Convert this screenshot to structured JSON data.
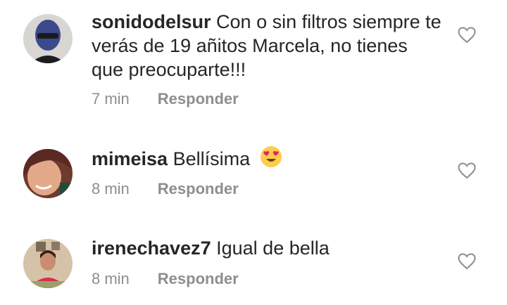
{
  "comments": [
    {
      "username": "sonidodelsur",
      "text": "Con o sin filtros siempre te verás de 19 añitos Marcela, no tienes que preocuparte!!!",
      "time": "7 min",
      "reply_label": "Responder",
      "avatar_icon": "profile-photo-sunglasses"
    },
    {
      "username": "mimeisa",
      "text": "Bellísima",
      "emoji": "heart-eyes-emoji",
      "time": "8 min",
      "reply_label": "Responder",
      "avatar_icon": "profile-photo-woman"
    },
    {
      "username": "irenechavez7",
      "text": "Igual de bella",
      "time": "8 min",
      "reply_label": "Responder",
      "avatar_icon": "profile-photo-woman-red"
    }
  ],
  "colors": {
    "text": "#262626",
    "muted": "#8e8e8e",
    "heart_outline": "#8e8e8e"
  }
}
